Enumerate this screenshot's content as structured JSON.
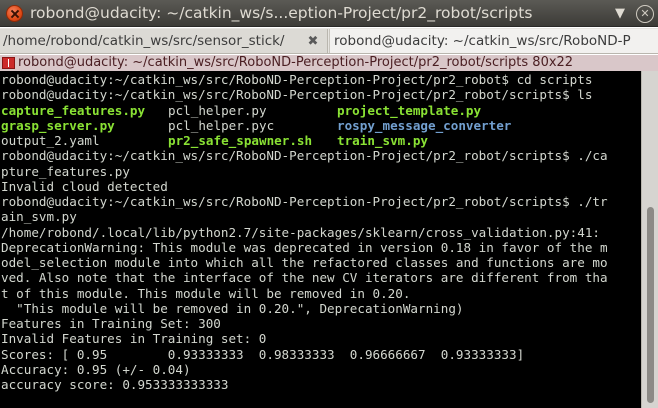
{
  "window": {
    "title": "robond@udacity: ~/catkin_ws/s...eption-Project/pr2_robot/scripts"
  },
  "tabs": [
    {
      "label": "/home/robond/catkin_ws/src/sensor_stick/"
    },
    {
      "label": "robond@udacity: ~/catkin_ws/src/RoboND-P"
    }
  ],
  "terminal_header": {
    "title": "robond@udacity: ~/catkin_ws/src/RoboND-Perception-Project/pr2_robot/scripts 80x22"
  },
  "terminal": {
    "lines": [
      "robond@udacity:~/catkin_ws/src/RoboND-Perception-Project/pr2_robot$ cd scripts",
      "robond@udacity:~/catkin_ws/src/RoboND-Perception-Project/pr2_robot/scripts$ ls",
      "",
      "",
      "",
      "robond@udacity:~/catkin_ws/src/RoboND-Perception-Project/pr2_robot/scripts$ ./ca",
      "pture_features.py",
      "Invalid cloud detected",
      "robond@udacity:~/catkin_ws/src/RoboND-Perception-Project/pr2_robot/scripts$ ./tr",
      "ain_svm.py",
      "/home/robond/.local/lib/python2.7/site-packages/sklearn/cross_validation.py:41:",
      "DeprecationWarning: This module was deprecated in version 0.18 in favor of the m",
      "odel_selection module into which all the refactored classes and functions are mo",
      "ved. Also note that the interface of the new CV iterators are different from tha",
      "t of this module. This module will be removed in 0.20.",
      "  \"This module will be removed in 0.20.\", DeprecationWarning)",
      "Features in Training Set: 300",
      "Invalid Features in Training set: 0",
      "Scores: [ 0.95        0.93333333  0.98333333  0.96666667  0.93333333]",
      "Accuracy: 0.95 (+/- 0.04)",
      "accuracy score: 0.953333333333"
    ],
    "ls_output": [
      [
        "capture_features.py",
        "pcl_helper.py",
        "project_template.py"
      ],
      [
        "grasp_server.py",
        "pcl_helper.pyc",
        "rospy_message_converter"
      ],
      [
        "output_2.yaml",
        "pr2_safe_spawner.sh",
        "train_svm.py"
      ]
    ],
    "ls_colors": [
      [
        "green",
        "white",
        "green"
      ],
      [
        "green",
        "white",
        "blue"
      ],
      [
        "white",
        "green",
        "green"
      ]
    ]
  },
  "colors": {
    "terminal_bg": "#000000",
    "terminal_fg": "#d3d7cf",
    "executable_green": "#8ae234",
    "directory_blue": "#729fcf",
    "header_bg": "#d9c7c9"
  }
}
